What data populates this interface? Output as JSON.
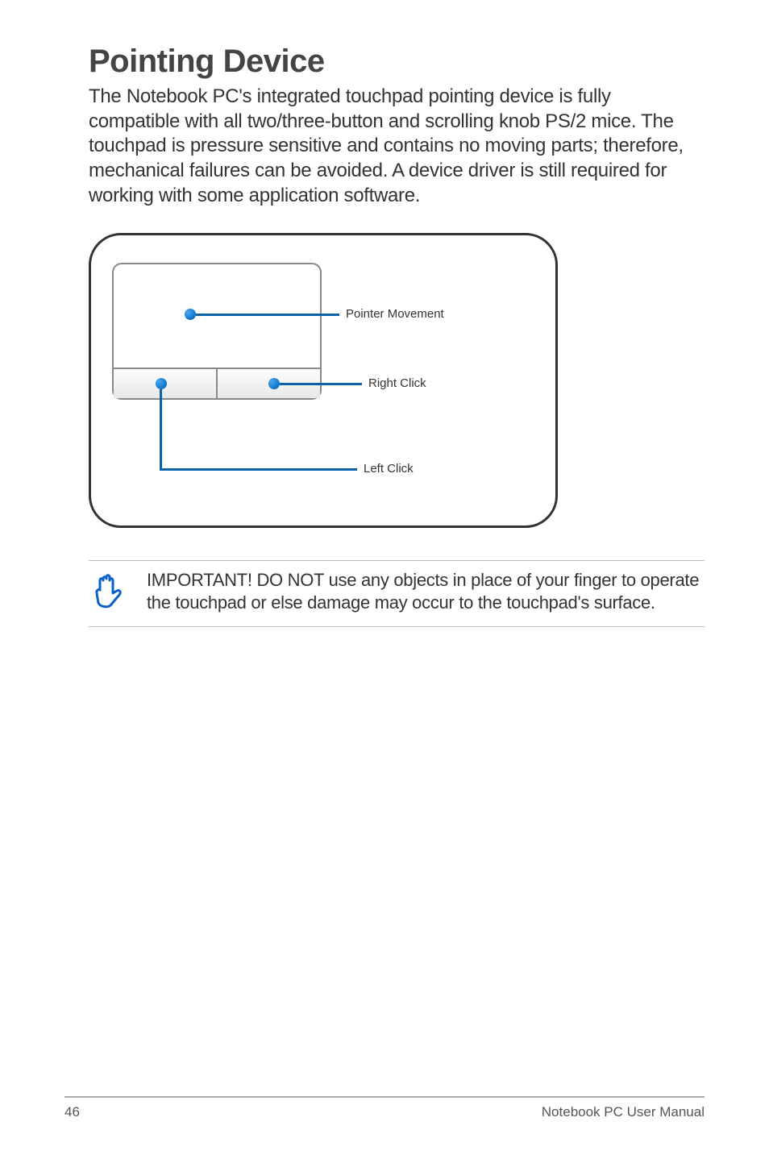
{
  "title": "Pointing Device",
  "body_text": "The Notebook PC's integrated touchpad pointing device is fully compatible with all two/three-button and scrolling knob PS/2 mice. The touchpad is pressure sensitive and contains no moving parts; therefore, mechanical failures can be avoided. A device driver is still required for working with some application software.",
  "diagram": {
    "labels": {
      "pointer_movement": "Pointer Movement",
      "right_click": "Right Click",
      "left_click": "Left Click"
    }
  },
  "note": {
    "icon": "hand-stop-icon",
    "text": "IMPORTANT! DO NOT use any objects in place of your finger to operate the touchpad or else damage may occur to the touchpad's surface."
  },
  "footer": {
    "page_number": "46",
    "manual_title": "Notebook PC User Manual"
  }
}
